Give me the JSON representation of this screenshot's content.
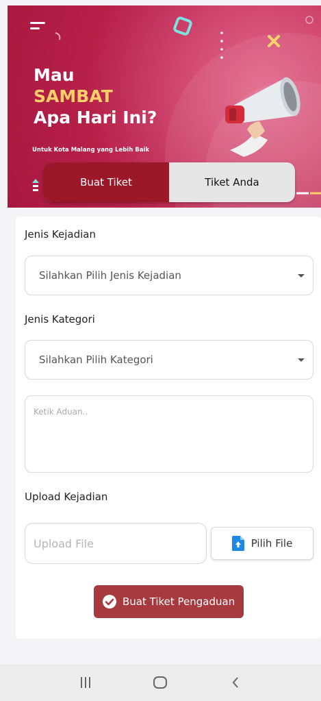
{
  "hero": {
    "title_line1": "Mau",
    "title_line2": "SAMBAT",
    "title_line3": "Apa Hari Ini?",
    "subtitle": "Untuk Kota Malang yang Lebih Baik"
  },
  "tabs": [
    {
      "label": "Buat Tiket",
      "active": true
    },
    {
      "label": "Tiket Anda",
      "active": false
    }
  ],
  "form": {
    "incident_type_label": "Jenis Kejadian",
    "incident_type_value": "Silahkan Pilih Jenis Kejadian",
    "category_label": "Jenis Kategori",
    "category_value": "Silahkan Pilih Kategori",
    "complaint_placeholder": "Ketik Aduan..",
    "upload_label": "Upload Kejadian",
    "upload_placeholder": "Upload File",
    "pick_file_label": "Pilih File",
    "submit_label": "Buat Tiket Pengaduan"
  },
  "colors": {
    "hero": "#b6214a",
    "accent_text": "#ffcf6a",
    "active_tab": "#9a1828",
    "submit": "#a63a3e",
    "file_icon": "#1e88e5"
  },
  "icons": [
    "menu-icon",
    "megaphone-icon",
    "file-upload-icon",
    "check-circle-icon",
    "recent-apps-icon",
    "home-icon",
    "back-icon"
  ]
}
